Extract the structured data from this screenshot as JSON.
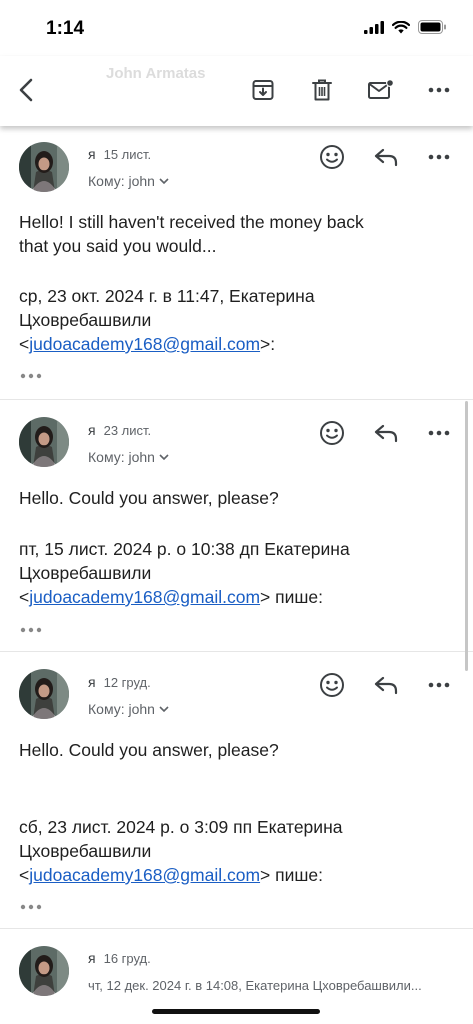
{
  "status": {
    "time": "1:14"
  },
  "toolbar": {
    "title": "John Armatas",
    "buttons": [
      "back-icon",
      "archive-icon",
      "delete-icon",
      "mark-unread-icon",
      "more-icon"
    ]
  },
  "colors": {
    "link": "#1a5ec4",
    "text": "#1f1f1f",
    "muted": "#5f6368"
  },
  "messages": [
    {
      "sender": "я",
      "date": "15 лист.",
      "to": "Кому: john",
      "body": [
        "Hello! I still haven't received the money back",
        "that you said you would..."
      ],
      "quote_line1": "ср, 23 окт. 2024 г. в 11:47, Екатерина",
      "quote_line2": "Цховребашвили",
      "email": "judoacademy168@gmail.com",
      "quote_open": "<",
      "quote_close": ">:"
    },
    {
      "sender": "я",
      "date": "23 лист.",
      "to": "Кому: john",
      "body": [
        "Hello. Could you answer, please?"
      ],
      "quote_line1": "пт, 15 лист. 2024 р. о 10:38 дп Екатерина",
      "quote_line2": "Цховребашвили",
      "email": "judoacademy168@gmail.com",
      "quote_open": "<",
      "quote_close": "> пише:"
    },
    {
      "sender": "я",
      "date": "12 груд.",
      "to": "Кому: john",
      "body": [
        "Hello. Could you answer, please?"
      ],
      "quote_line1": "сб, 23 лист. 2024 р. о 3:09 пп Екатерина",
      "quote_line2": "Цховребашвили",
      "email": "judoacademy168@gmail.com",
      "quote_open": "<",
      "quote_close": "> пише:"
    },
    {
      "sender": "я",
      "date": "16 груд.",
      "snippet": "чт, 12 дек. 2024 г. в 14:08, Екатерина Цховребашвили..."
    }
  ]
}
